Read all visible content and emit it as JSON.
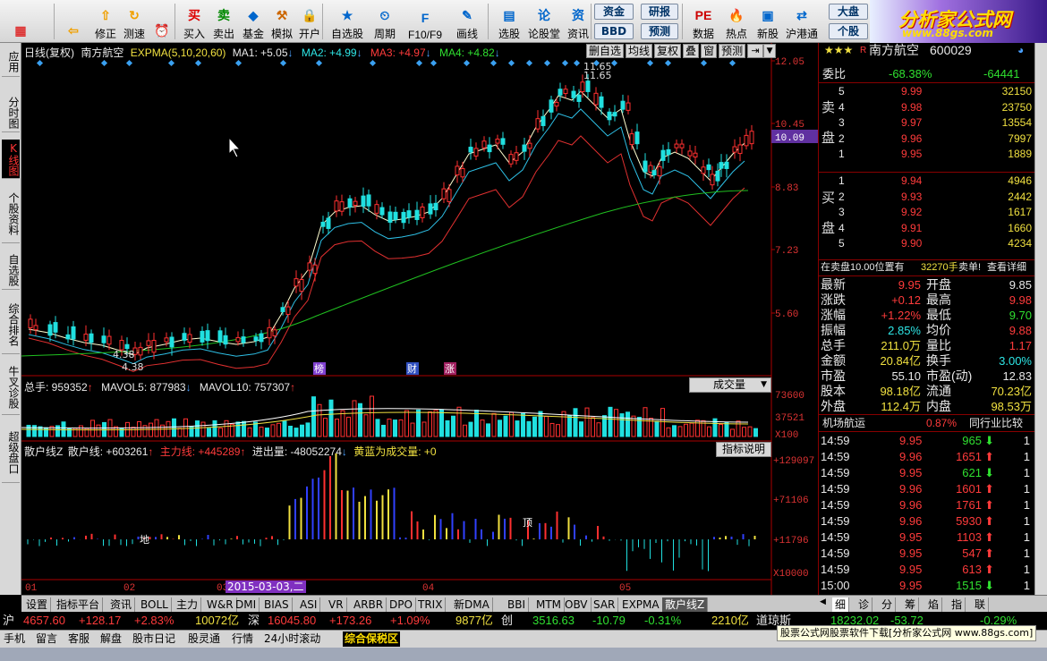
{
  "toolbar": {
    "items": [
      {
        "label": "",
        "icon": "windows-icon",
        "color": "#d33"
      },
      {
        "label": "",
        "icon": "back-arrow-icon",
        "color": "#f0a000"
      },
      {
        "label": "修正",
        "icon": "up-down-arrow-icon",
        "color": "#f0a000"
      },
      {
        "label": "测速",
        "icon": "refresh-icon",
        "color": "#f0a000"
      },
      {
        "label": "",
        "icon": "clock-icon",
        "color": "#c60"
      },
      {
        "label": "买入",
        "icon": "buy-icon",
        "color": "#d00"
      },
      {
        "label": "卖出",
        "icon": "sell-icon",
        "color": "#080"
      },
      {
        "label": "基金",
        "icon": "fund-icon",
        "color": "#06c"
      },
      {
        "label": "模拟",
        "icon": "hammer-icon",
        "color": "#c60"
      },
      {
        "label": "开户",
        "icon": "lock-icon",
        "color": "#c90"
      },
      {
        "label": "自选股",
        "icon": "star-list-icon",
        "color": "#06c"
      },
      {
        "label": "周期",
        "icon": "period-icon",
        "color": "#06c"
      },
      {
        "label": "F10/F9",
        "icon": "f10-icon",
        "color": "#06c"
      },
      {
        "label": "画线",
        "icon": "pen-icon",
        "color": "#06c"
      },
      {
        "label": "选股",
        "icon": "select-stock-icon",
        "color": "#06c"
      },
      {
        "label": "论股堂",
        "icon": "forum-icon",
        "color": "#06c"
      },
      {
        "label": "资讯",
        "icon": "news-icon",
        "color": "#06c"
      },
      {
        "label": "资金",
        "icon": "fund-flow-icon",
        "color": "#036"
      },
      {
        "label": "BBD",
        "icon": "bbd-icon",
        "color": "#036"
      },
      {
        "label": "研报",
        "icon": "report-icon",
        "color": "#036"
      },
      {
        "label": "预测",
        "icon": "forecast-icon",
        "color": "#036"
      },
      {
        "label": "数据",
        "icon": "pe-icon",
        "color": "#c00"
      },
      {
        "label": "热点",
        "icon": "hot-icon",
        "color": "#c00"
      },
      {
        "label": "新股",
        "icon": "ipo-icon",
        "color": "#06c"
      },
      {
        "label": "沪港通",
        "icon": "shhk-icon",
        "color": "#06c"
      },
      {
        "label": "大盘",
        "icon": "index-icon",
        "color": "#036"
      },
      {
        "label": "个股",
        "icon": "stock-icon",
        "color": "#036"
      }
    ],
    "fund_btn": "资金",
    "bbd_btn": "BBD",
    "yanbao": "研报",
    "yuce": "预测",
    "pe": "PE",
    "dapan": "大盘",
    "gegu": "个股"
  },
  "logo": {
    "line1": "分析家公式网",
    "line2": "www.88gs.com"
  },
  "left_tabs": [
    "应用",
    "分时图",
    "K线图",
    "个股资料",
    "自选股",
    "综合排名",
    "牛叉诊股",
    "超级盘口"
  ],
  "kline": {
    "title": "日线(复权)",
    "stock": "南方航空",
    "ind_label": "EXPMA(5,10,20,60)",
    "ma1": "MA1: +5.05",
    "ma2": "MA2: +4.99",
    "ma3": "MA3: +4.97",
    "ma4": "MA4: +4.82",
    "buttons": [
      "删自选",
      "均线",
      "复权",
      "叠",
      "窗",
      "预测"
    ],
    "y_labels": [
      "12.05",
      "10.45",
      "8.83",
      "7.23",
      "5.60"
    ],
    "current_price": "10.09",
    "high_mark": "11.65",
    "low_mark": "4.38",
    "tags": [
      "榜",
      "财",
      "涨"
    ]
  },
  "volume": {
    "title": "总手: 959352",
    "mavol5": "MAVOL5: 877983",
    "mavol10": "MAVOL10: 757307",
    "selector": "成交量",
    "y_labels": [
      "73600",
      "37521",
      "X100"
    ]
  },
  "sanhu": {
    "title": "散户线Z",
    "line": "散户线: +603261",
    "main": "主力线: +445289",
    "inout": "进出量: -48052274",
    "note": "黄蓝为成交量: +0",
    "explain_btn": "指标说明",
    "y_labels": [
      "+129097",
      "+71106",
      "+11796",
      "X10000"
    ],
    "marks": [
      "地",
      "顶"
    ]
  },
  "x_axis": {
    "labels": [
      "01",
      "02",
      "03",
      "04",
      "05"
    ],
    "cursor_date": "2015-03-03,二"
  },
  "quote": {
    "name": "南方航空",
    "code": "600029",
    "weibi_label": "委比",
    "weibi": "-68.38%",
    "weicha": "-64441",
    "sell_label": "卖盘",
    "buy_label": "买盘",
    "sells": [
      {
        "n": "5",
        "p": "9.99",
        "v": "32150"
      },
      {
        "n": "4",
        "p": "9.98",
        "v": "23750"
      },
      {
        "n": "3",
        "p": "9.97",
        "v": "13554"
      },
      {
        "n": "2",
        "p": "9.96",
        "v": "7997"
      },
      {
        "n": "1",
        "p": "9.95",
        "v": "1889"
      }
    ],
    "buys": [
      {
        "n": "1",
        "p": "9.94",
        "v": "4946"
      },
      {
        "n": "2",
        "p": "9.93",
        "v": "2442"
      },
      {
        "n": "3",
        "p": "9.92",
        "v": "1617"
      },
      {
        "n": "4",
        "p": "9.91",
        "v": "1660"
      },
      {
        "n": "5",
        "p": "9.90",
        "v": "4234"
      }
    ],
    "notice_a": "在卖盘10.00位置有",
    "notice_b": "32270手",
    "notice_c": "卖单!",
    "notice_d": "查看详细",
    "stats": [
      {
        "l1": "最新",
        "v1": "9.95",
        "l2": "开盘",
        "v2": "9.85"
      },
      {
        "l1": "涨跌",
        "v1": "+0.12",
        "l2": "最高",
        "v2": "9.98"
      },
      {
        "l1": "涨幅",
        "v1": "+1.22%",
        "l2": "最低",
        "v2": "9.70"
      },
      {
        "l1": "振幅",
        "v1": "2.85%",
        "l2": "均价",
        "v2": "9.88"
      },
      {
        "l1": "总手",
        "v1": "211.0万",
        "l2": "量比",
        "v2": "1.17"
      },
      {
        "l1": "金额",
        "v1": "20.84亿",
        "l2": "换手",
        "v2": "3.00%"
      },
      {
        "l1": "市盈",
        "v1": "55.10",
        "l2": "市盈(动)",
        "v2": "12.83"
      },
      {
        "l1": "股本",
        "v1": "98.18亿",
        "l2": "流通",
        "v2": "70.23亿"
      },
      {
        "l1": "外盘",
        "v1": "112.4万",
        "l2": "内盘",
        "v2": "98.53万"
      }
    ],
    "industry": "机场航运",
    "industry_pct": "0.87%",
    "compare": "同行业比较",
    "ticks": [
      {
        "t": "14:59",
        "p": "9.95",
        "v": "965",
        "d": "down"
      },
      {
        "t": "14:59",
        "p": "9.96",
        "v": "1651",
        "d": "up"
      },
      {
        "t": "14:59",
        "p": "9.95",
        "v": "621",
        "d": "down"
      },
      {
        "t": "14:59",
        "p": "9.96",
        "v": "1601",
        "d": "up"
      },
      {
        "t": "14:59",
        "p": "9.96",
        "v": "1761",
        "d": "up"
      },
      {
        "t": "14:59",
        "p": "9.96",
        "v": "5930",
        "d": "up"
      },
      {
        "t": "14:59",
        "p": "9.95",
        "v": "1103",
        "d": "up"
      },
      {
        "t": "14:59",
        "p": "9.95",
        "v": "547",
        "d": "up"
      },
      {
        "t": "14:59",
        "p": "9.95",
        "v": "613",
        "d": "up"
      },
      {
        "t": "15:00",
        "p": "9.95",
        "v": "1515",
        "d": "down"
      }
    ],
    "tick_counts": [
      "1",
      "1",
      "1",
      "1",
      "1",
      "1",
      "1",
      "1",
      "1",
      "1"
    ],
    "bottom_tabs": [
      "细",
      "诊",
      "分",
      "筹",
      "焰",
      "指",
      "联"
    ]
  },
  "bottom_tabs": [
    "设置",
    "指标平台",
    "资讯",
    "BOLL",
    "主力",
    "W&R",
    "DMI",
    "BIAS",
    "ASI",
    "VR",
    "ARBR",
    "DPO",
    "TRIX",
    "新DMA",
    "BBI",
    "MTM",
    "OBV",
    "SAR",
    "EXPMA",
    "散户线Z"
  ],
  "ticker": {
    "sh_label": "沪",
    "sh_idx": "4657.60",
    "sh_chg": "+128.17",
    "sh_pct": "+2.83%",
    "sh_amt": "10072亿",
    "sz_label": "深",
    "sz_idx": "16045.80",
    "sz_chg": "+173.26",
    "sz_pct": "+1.09%",
    "sz_amt": "9877亿",
    "cy_label": "创",
    "cy_idx": "3516.63",
    "cy_chg": "-10.79",
    "cy_pct": "-0.31%",
    "cy_amt": "2210亿",
    "dj_label": "道琼斯",
    "dj_idx": "18232.02",
    "dj_chg": "-53.72",
    "dj_pct": "-0.29%"
  },
  "statusbar": {
    "items": [
      "手机",
      "留言",
      "客服",
      "解盘",
      "股市日记",
      "股灵通",
      "行情",
      "24小时滚动"
    ],
    "highlight": "综合保税区",
    "promo": "股票公式网股票软件下载[分析家公式网 www.88gs.com]"
  }
}
